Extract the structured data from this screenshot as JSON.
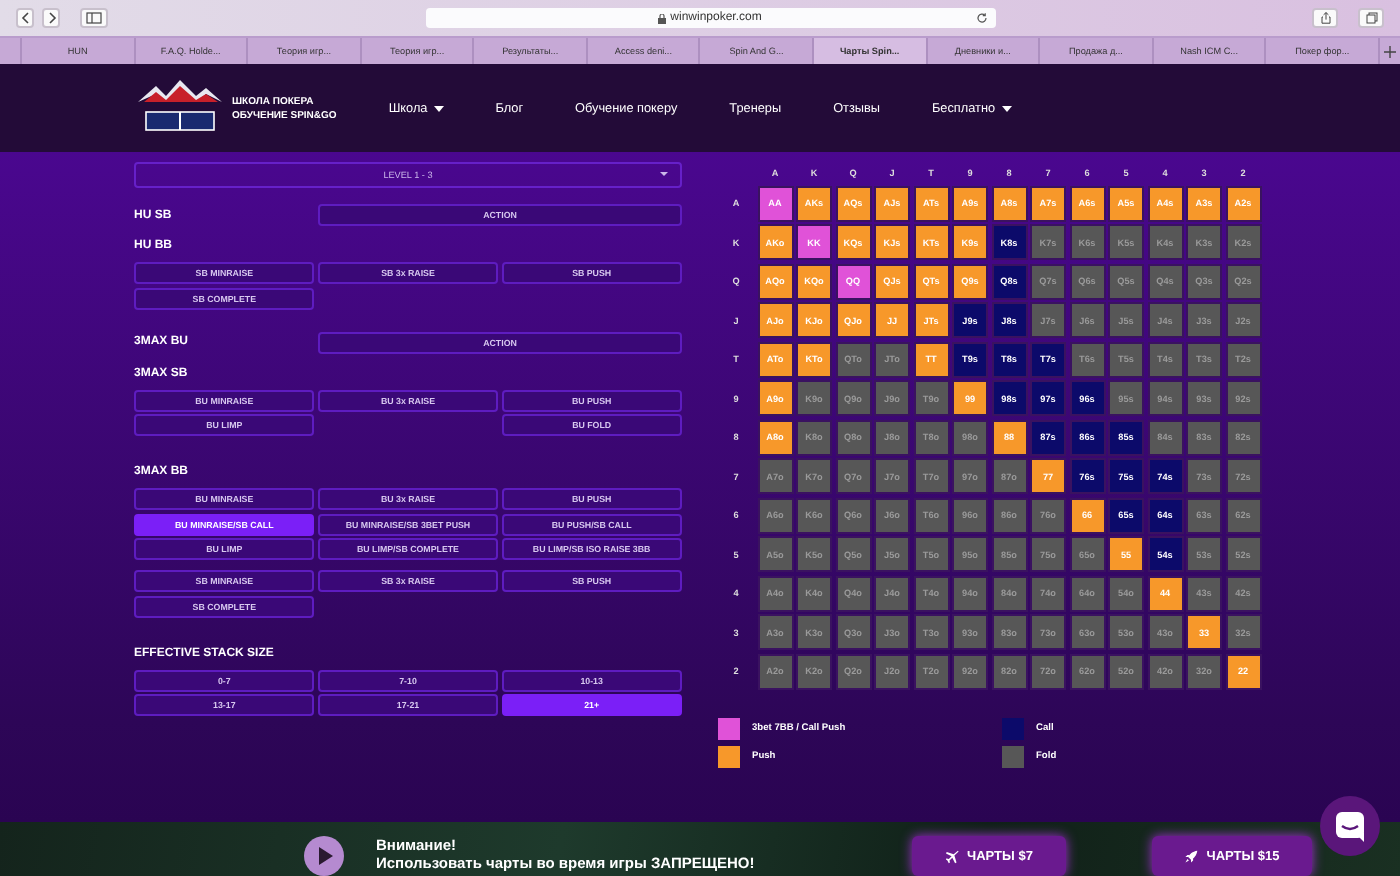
{
  "browser": {
    "url": "winwinpoker.com",
    "tabs": [
      {
        "selected": false
      },
      {
        "label": "HUN",
        "selected": false
      },
      {
        "label": "F.A.Q. Holde...",
        "selected": false
      },
      {
        "label": "Теория игр...",
        "selected": false
      },
      {
        "label": "Теория игр...",
        "selected": false
      },
      {
        "label": "Результаты...",
        "selected": false
      },
      {
        "label": "Access deni...",
        "selected": false
      },
      {
        "label": "Spin And G...",
        "selected": false
      },
      {
        "label": "Чарты Spin...",
        "selected": true
      },
      {
        "label": "Дневники и...",
        "selected": false
      },
      {
        "label": "Продажа д...",
        "selected": false
      },
      {
        "label": "Nash ICM C...",
        "selected": false
      },
      {
        "label": "Покер фор...",
        "selected": false
      }
    ]
  },
  "header": {
    "logo_lines": [
      "ШКОЛА ПОКЕРА",
      "ОБУЧЕНИЕ SPIN&GO"
    ],
    "nav": [
      {
        "label": "Школа",
        "dropdown": true
      },
      {
        "label": "Блог",
        "dropdown": false
      },
      {
        "label": "Обучение покеру",
        "dropdown": false
      },
      {
        "label": "Тренеры",
        "dropdown": false
      },
      {
        "label": "Отзывы",
        "dropdown": false
      },
      {
        "label": "Бесплатно",
        "dropdown": true
      }
    ]
  },
  "level_select": {
    "value": "LEVEL 1 - 3"
  },
  "sections": [
    {
      "title": "HU SB",
      "kind": "inline",
      "buttons": [
        {
          "label": "ACTION",
          "selected": false
        }
      ]
    },
    {
      "title": "HU BB",
      "kind": "grid",
      "groups": [
        {
          "rows": [
            [
              {
                "label": "SB MINRAISE",
                "selected": false
              },
              {
                "label": "SB 3x RAISE",
                "selected": false
              },
              {
                "label": "SB PUSH",
                "selected": false
              }
            ],
            [
              {
                "label": "SB COMPLETE",
                "selected": false
              },
              null,
              null
            ]
          ]
        }
      ]
    },
    {
      "title": "3MAX BU",
      "kind": "inline",
      "buttons": [
        {
          "label": "ACTION",
          "selected": false
        }
      ]
    },
    {
      "title": "3MAX SB",
      "kind": "grid",
      "groups": [
        {
          "rows": [
            [
              {
                "label": "BU MINRAISE",
                "selected": false
              },
              {
                "label": "BU 3x RAISE",
                "selected": false
              },
              {
                "label": "BU PUSH",
                "selected": false
              }
            ],
            [
              {
                "label": "BU LIMP",
                "selected": false
              },
              null,
              {
                "label": "BU FOLD",
                "selected": false
              }
            ]
          ]
        }
      ]
    },
    {
      "title": "3MAX BB",
      "kind": "grid",
      "groups": [
        {
          "rows": [
            [
              {
                "label": "BU MINRAISE",
                "selected": false
              },
              {
                "label": "BU 3x RAISE",
                "selected": false
              },
              {
                "label": "BU PUSH",
                "selected": false
              }
            ],
            [
              {
                "label": "BU MINRAISE/SB CALL",
                "selected": true
              },
              {
                "label": "BU MINRAISE/SB 3BET PUSH",
                "selected": false
              },
              {
                "label": "BU PUSH/SB CALL",
                "selected": false
              }
            ],
            [
              {
                "label": "BU LIMP",
                "selected": false
              },
              {
                "label": "BU LIMP/SB COMPLETE",
                "selected": false
              },
              {
                "label": "BU LIMP/SB ISO RAISE 3BB",
                "selected": false
              }
            ]
          ]
        },
        {
          "rows": [
            [
              {
                "label": "SB MINRAISE",
                "selected": false
              },
              {
                "label": "SB 3x RAISE",
                "selected": false
              },
              {
                "label": "SB PUSH",
                "selected": false
              }
            ],
            [
              {
                "label": "SB COMPLETE",
                "selected": false
              },
              null,
              null
            ]
          ]
        }
      ]
    },
    {
      "title": "EFFECTIVE STACK SIZE",
      "kind": "grid",
      "groups": [
        {
          "rows": [
            [
              {
                "label": "0-7",
                "selected": false
              },
              {
                "label": "7-10",
                "selected": false
              },
              {
                "label": "10-13",
                "selected": false
              }
            ],
            [
              {
                "label": "13-17",
                "selected": false
              },
              {
                "label": "17-21",
                "selected": false
              },
              {
                "label": "21+",
                "selected": true
              }
            ]
          ]
        }
      ]
    }
  ],
  "chart": {
    "columns": [
      "A",
      "K",
      "Q",
      "J",
      "T",
      "9",
      "8",
      "7",
      "6",
      "5",
      "4",
      "3",
      "2"
    ],
    "rows": [
      {
        "label": "A",
        "cells": [
          {
            "hand": "AA",
            "kind": "threebet"
          },
          {
            "hand": "AKs",
            "kind": "push"
          },
          {
            "hand": "AQs",
            "kind": "push"
          },
          {
            "hand": "AJs",
            "kind": "push"
          },
          {
            "hand": "ATs",
            "kind": "push"
          },
          {
            "hand": "A9s",
            "kind": "push"
          },
          {
            "hand": "A8s",
            "kind": "push"
          },
          {
            "hand": "A7s",
            "kind": "push"
          },
          {
            "hand": "A6s",
            "kind": "push"
          },
          {
            "hand": "A5s",
            "kind": "push"
          },
          {
            "hand": "A4s",
            "kind": "push"
          },
          {
            "hand": "A3s",
            "kind": "push"
          },
          {
            "hand": "A2s",
            "kind": "push"
          }
        ]
      },
      {
        "label": "K",
        "cells": [
          {
            "hand": "AKo",
            "kind": "push"
          },
          {
            "hand": "KK",
            "kind": "threebet"
          },
          {
            "hand": "KQs",
            "kind": "push"
          },
          {
            "hand": "KJs",
            "kind": "push"
          },
          {
            "hand": "KTs",
            "kind": "push"
          },
          {
            "hand": "K9s",
            "kind": "push"
          },
          {
            "hand": "K8s",
            "kind": "call"
          },
          {
            "hand": "K7s",
            "kind": "fold"
          },
          {
            "hand": "K6s",
            "kind": "fold"
          },
          {
            "hand": "K5s",
            "kind": "fold"
          },
          {
            "hand": "K4s",
            "kind": "fold"
          },
          {
            "hand": "K3s",
            "kind": "fold"
          },
          {
            "hand": "K2s",
            "kind": "fold"
          }
        ]
      },
      {
        "label": "Q",
        "cells": [
          {
            "hand": "AQo",
            "kind": "push"
          },
          {
            "hand": "KQo",
            "kind": "push"
          },
          {
            "hand": "QQ",
            "kind": "threebet"
          },
          {
            "hand": "QJs",
            "kind": "push"
          },
          {
            "hand": "QTs",
            "kind": "push"
          },
          {
            "hand": "Q9s",
            "kind": "push"
          },
          {
            "hand": "Q8s",
            "kind": "call"
          },
          {
            "hand": "Q7s",
            "kind": "fold"
          },
          {
            "hand": "Q6s",
            "kind": "fold"
          },
          {
            "hand": "Q5s",
            "kind": "fold"
          },
          {
            "hand": "Q4s",
            "kind": "fold"
          },
          {
            "hand": "Q3s",
            "kind": "fold"
          },
          {
            "hand": "Q2s",
            "kind": "fold"
          }
        ]
      },
      {
        "label": "J",
        "cells": [
          {
            "hand": "AJo",
            "kind": "push"
          },
          {
            "hand": "KJo",
            "kind": "push"
          },
          {
            "hand": "QJo",
            "kind": "push"
          },
          {
            "hand": "JJ",
            "kind": "push"
          },
          {
            "hand": "JTs",
            "kind": "push"
          },
          {
            "hand": "J9s",
            "kind": "call"
          },
          {
            "hand": "J8s",
            "kind": "call"
          },
          {
            "hand": "J7s",
            "kind": "fold"
          },
          {
            "hand": "J6s",
            "kind": "fold"
          },
          {
            "hand": "J5s",
            "kind": "fold"
          },
          {
            "hand": "J4s",
            "kind": "fold"
          },
          {
            "hand": "J3s",
            "kind": "fold"
          },
          {
            "hand": "J2s",
            "kind": "fold"
          }
        ]
      },
      {
        "label": "T",
        "cells": [
          {
            "hand": "ATo",
            "kind": "push"
          },
          {
            "hand": "KTo",
            "kind": "push"
          },
          {
            "hand": "QTo",
            "kind": "fold"
          },
          {
            "hand": "JTo",
            "kind": "fold"
          },
          {
            "hand": "TT",
            "kind": "push"
          },
          {
            "hand": "T9s",
            "kind": "call"
          },
          {
            "hand": "T8s",
            "kind": "call"
          },
          {
            "hand": "T7s",
            "kind": "call"
          },
          {
            "hand": "T6s",
            "kind": "fold"
          },
          {
            "hand": "T5s",
            "kind": "fold"
          },
          {
            "hand": "T4s",
            "kind": "fold"
          },
          {
            "hand": "T3s",
            "kind": "fold"
          },
          {
            "hand": "T2s",
            "kind": "fold"
          }
        ]
      },
      {
        "label": "9",
        "cells": [
          {
            "hand": "A9o",
            "kind": "push"
          },
          {
            "hand": "K9o",
            "kind": "fold"
          },
          {
            "hand": "Q9o",
            "kind": "fold"
          },
          {
            "hand": "J9o",
            "kind": "fold"
          },
          {
            "hand": "T9o",
            "kind": "fold"
          },
          {
            "hand": "99",
            "kind": "push"
          },
          {
            "hand": "98s",
            "kind": "call"
          },
          {
            "hand": "97s",
            "kind": "call"
          },
          {
            "hand": "96s",
            "kind": "call"
          },
          {
            "hand": "95s",
            "kind": "fold"
          },
          {
            "hand": "94s",
            "kind": "fold"
          },
          {
            "hand": "93s",
            "kind": "fold"
          },
          {
            "hand": "92s",
            "kind": "fold"
          }
        ]
      },
      {
        "label": "8",
        "cells": [
          {
            "hand": "A8o",
            "kind": "push"
          },
          {
            "hand": "K8o",
            "kind": "fold"
          },
          {
            "hand": "Q8o",
            "kind": "fold"
          },
          {
            "hand": "J8o",
            "kind": "fold"
          },
          {
            "hand": "T8o",
            "kind": "fold"
          },
          {
            "hand": "98o",
            "kind": "fold"
          },
          {
            "hand": "88",
            "kind": "push"
          },
          {
            "hand": "87s",
            "kind": "call"
          },
          {
            "hand": "86s",
            "kind": "call"
          },
          {
            "hand": "85s",
            "kind": "call"
          },
          {
            "hand": "84s",
            "kind": "fold"
          },
          {
            "hand": "83s",
            "kind": "fold"
          },
          {
            "hand": "82s",
            "kind": "fold"
          }
        ]
      },
      {
        "label": "7",
        "cells": [
          {
            "hand": "A7o",
            "kind": "fold"
          },
          {
            "hand": "K7o",
            "kind": "fold"
          },
          {
            "hand": "Q7o",
            "kind": "fold"
          },
          {
            "hand": "J7o",
            "kind": "fold"
          },
          {
            "hand": "T7o",
            "kind": "fold"
          },
          {
            "hand": "97o",
            "kind": "fold"
          },
          {
            "hand": "87o",
            "kind": "fold"
          },
          {
            "hand": "77",
            "kind": "push"
          },
          {
            "hand": "76s",
            "kind": "call"
          },
          {
            "hand": "75s",
            "kind": "call"
          },
          {
            "hand": "74s",
            "kind": "call"
          },
          {
            "hand": "73s",
            "kind": "fold"
          },
          {
            "hand": "72s",
            "kind": "fold"
          }
        ]
      },
      {
        "label": "6",
        "cells": [
          {
            "hand": "A6o",
            "kind": "fold"
          },
          {
            "hand": "K6o",
            "kind": "fold"
          },
          {
            "hand": "Q6o",
            "kind": "fold"
          },
          {
            "hand": "J6o",
            "kind": "fold"
          },
          {
            "hand": "T6o",
            "kind": "fold"
          },
          {
            "hand": "96o",
            "kind": "fold"
          },
          {
            "hand": "86o",
            "kind": "fold"
          },
          {
            "hand": "76o",
            "kind": "fold"
          },
          {
            "hand": "66",
            "kind": "push"
          },
          {
            "hand": "65s",
            "kind": "call"
          },
          {
            "hand": "64s",
            "kind": "call"
          },
          {
            "hand": "63s",
            "kind": "fold"
          },
          {
            "hand": "62s",
            "kind": "fold"
          }
        ]
      },
      {
        "label": "5",
        "cells": [
          {
            "hand": "A5o",
            "kind": "fold"
          },
          {
            "hand": "K5o",
            "kind": "fold"
          },
          {
            "hand": "Q5o",
            "kind": "fold"
          },
          {
            "hand": "J5o",
            "kind": "fold"
          },
          {
            "hand": "T5o",
            "kind": "fold"
          },
          {
            "hand": "95o",
            "kind": "fold"
          },
          {
            "hand": "85o",
            "kind": "fold"
          },
          {
            "hand": "75o",
            "kind": "fold"
          },
          {
            "hand": "65o",
            "kind": "fold"
          },
          {
            "hand": "55",
            "kind": "push"
          },
          {
            "hand": "54s",
            "kind": "call"
          },
          {
            "hand": "53s",
            "kind": "fold"
          },
          {
            "hand": "52s",
            "kind": "fold"
          }
        ]
      },
      {
        "label": "4",
        "cells": [
          {
            "hand": "A4o",
            "kind": "fold"
          },
          {
            "hand": "K4o",
            "kind": "fold"
          },
          {
            "hand": "Q4o",
            "kind": "fold"
          },
          {
            "hand": "J4o",
            "kind": "fold"
          },
          {
            "hand": "T4o",
            "kind": "fold"
          },
          {
            "hand": "94o",
            "kind": "fold"
          },
          {
            "hand": "84o",
            "kind": "fold"
          },
          {
            "hand": "74o",
            "kind": "fold"
          },
          {
            "hand": "64o",
            "kind": "fold"
          },
          {
            "hand": "54o",
            "kind": "fold"
          },
          {
            "hand": "44",
            "kind": "push"
          },
          {
            "hand": "43s",
            "kind": "fold"
          },
          {
            "hand": "42s",
            "kind": "fold"
          }
        ]
      },
      {
        "label": "3",
        "cells": [
          {
            "hand": "A3o",
            "kind": "fold"
          },
          {
            "hand": "K3o",
            "kind": "fold"
          },
          {
            "hand": "Q3o",
            "kind": "fold"
          },
          {
            "hand": "J3o",
            "kind": "fold"
          },
          {
            "hand": "T3o",
            "kind": "fold"
          },
          {
            "hand": "93o",
            "kind": "fold"
          },
          {
            "hand": "83o",
            "kind": "fold"
          },
          {
            "hand": "73o",
            "kind": "fold"
          },
          {
            "hand": "63o",
            "kind": "fold"
          },
          {
            "hand": "53o",
            "kind": "fold"
          },
          {
            "hand": "43o",
            "kind": "fold"
          },
          {
            "hand": "33",
            "kind": "push"
          },
          {
            "hand": "32s",
            "kind": "fold"
          }
        ]
      },
      {
        "label": "2",
        "cells": [
          {
            "hand": "A2o",
            "kind": "fold"
          },
          {
            "hand": "K2o",
            "kind": "fold"
          },
          {
            "hand": "Q2o",
            "kind": "fold"
          },
          {
            "hand": "J2o",
            "kind": "fold"
          },
          {
            "hand": "T2o",
            "kind": "fold"
          },
          {
            "hand": "92o",
            "kind": "fold"
          },
          {
            "hand": "82o",
            "kind": "fold"
          },
          {
            "hand": "72o",
            "kind": "fold"
          },
          {
            "hand": "62o",
            "kind": "fold"
          },
          {
            "hand": "52o",
            "kind": "fold"
          },
          {
            "hand": "42o",
            "kind": "fold"
          },
          {
            "hand": "32o",
            "kind": "fold"
          },
          {
            "hand": "22",
            "kind": "push"
          }
        ]
      }
    ],
    "legend": [
      {
        "label": "3bet 7BB / Call Push",
        "kind": "threebet",
        "color": "#e052d8"
      },
      {
        "label": "Call",
        "kind": "call",
        "color": "#0c0a6a"
      },
      {
        "label": "Push",
        "kind": "push",
        "color": "#f7982a"
      },
      {
        "label": "Fold",
        "kind": "fold",
        "color": "#575757"
      }
    ]
  },
  "banner": {
    "title": "Внимание!",
    "text": "Использовать чарты во время игры ЗАПРЕЩЕНО!",
    "buttons": [
      {
        "label": "ЧАРТЫ $7",
        "kind": "plane"
      },
      {
        "label": "ЧАРТЫ $15",
        "kind": "rocket"
      }
    ]
  }
}
